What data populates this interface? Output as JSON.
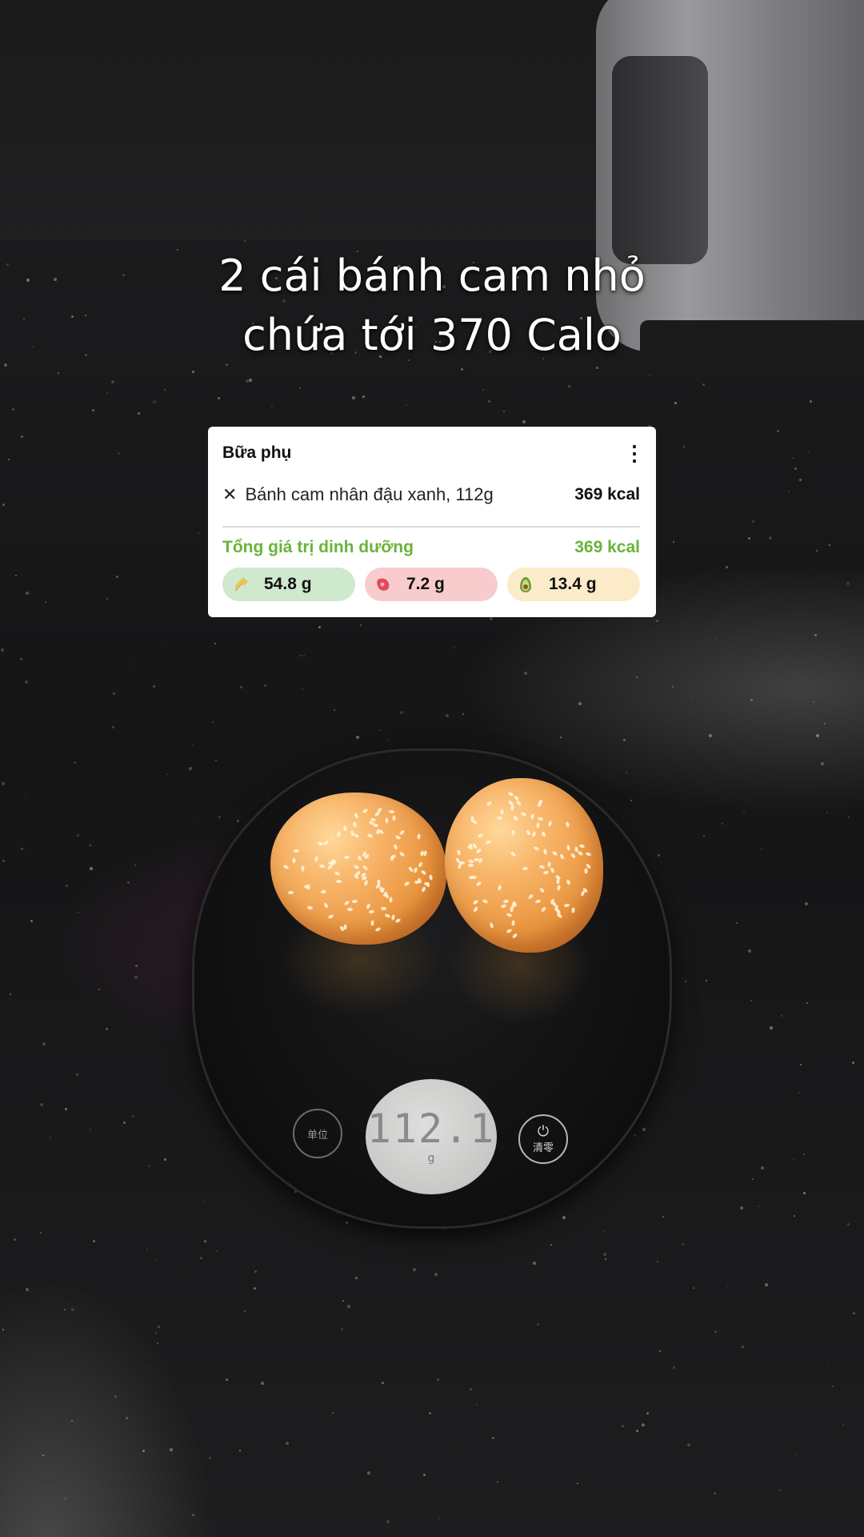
{
  "headline": {
    "line1": "2 cái bánh cam nhỏ",
    "line2": "chứa tới 370 Calo"
  },
  "card": {
    "title": "Bữa phụ",
    "item": {
      "name": "Bánh cam nhân đậu xanh, 112g",
      "kcal": "369 kcal"
    },
    "total_label": "Tổng giá trị dinh dưỡng",
    "total_kcal": "369 kcal",
    "macros": {
      "carbs": "54.8 g",
      "protein": "7.2 g",
      "fat": "13.4 g"
    },
    "icons": {
      "menu": "more-vertical-icon",
      "remove": "close-icon",
      "carbs": "wheat-icon",
      "protein": "meat-icon",
      "fat": "avocado-icon"
    },
    "colors": {
      "accent_green": "#6ab33b",
      "carbs_bg": "#cfe9cf",
      "protein_bg": "#f8cccc",
      "fat_bg": "#fbebc8"
    }
  },
  "scale": {
    "reading": "112.1",
    "unit": "g",
    "left_button": "单位",
    "right_button": "清零"
  }
}
